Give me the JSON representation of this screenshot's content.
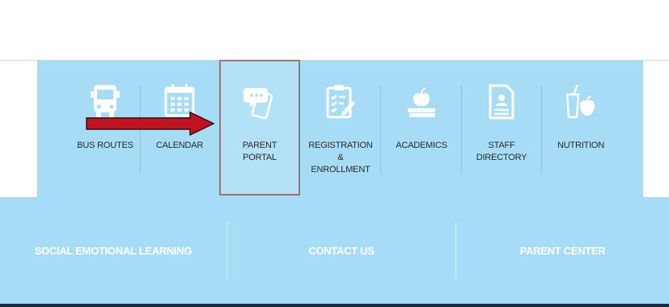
{
  "quick_links": [
    {
      "label": "BUS ROUTES",
      "icon": "bus-icon"
    },
    {
      "label": "CALENDAR",
      "icon": "calendar-icon"
    },
    {
      "label": "PARENT\nPORTAL",
      "icon": "phone-chat-icon"
    },
    {
      "label": "REGISTRATION\n&\nENROLLMENT",
      "icon": "clipboard-icon"
    },
    {
      "label": "ACADEMICS",
      "icon": "books-apple-icon"
    },
    {
      "label": "STAFF\nDIRECTORY",
      "icon": "directory-document-icon"
    },
    {
      "label": "NUTRITION",
      "icon": "drink-apple-icon"
    }
  ],
  "bottom_links": [
    {
      "label": "SOCIAL EMOTIONAL LEARNING"
    },
    {
      "label": "CONTACT US"
    },
    {
      "label": "PARENT CENTER"
    }
  ],
  "colors": {
    "panel": "#a6dcf5",
    "icon": "#ffffff",
    "arrow": "#c0131f",
    "highlight_border": "#9b7378",
    "footer": "#1b2a4a"
  }
}
